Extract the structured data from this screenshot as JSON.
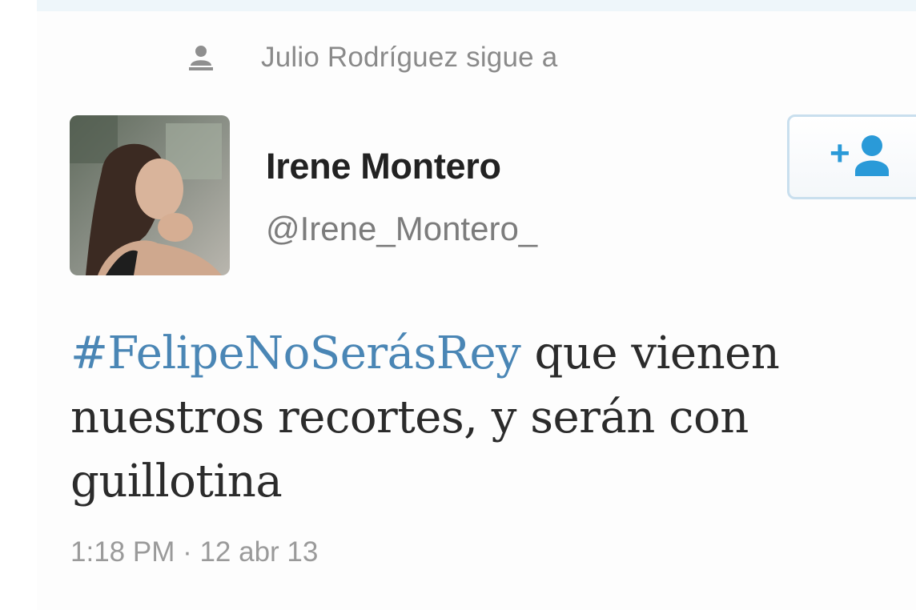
{
  "context": {
    "icon": "person-icon",
    "text": "Julio Rodríguez sigue a"
  },
  "user": {
    "display_name": "Irene Montero",
    "handle": "@Irene_Montero_",
    "avatar_icon": "profile-photo"
  },
  "follow_button": {
    "plus": "+",
    "icon": "follow-person-icon",
    "accent": "#2a9ad8"
  },
  "tweet": {
    "hashtag": "#FelipeNoSerásRey",
    "text": " que vienen nuestros recortes, y serán con guillotina",
    "hashtag_color": "#4a86b5"
  },
  "timestamp": "1:18 PM · 12 abr 13"
}
